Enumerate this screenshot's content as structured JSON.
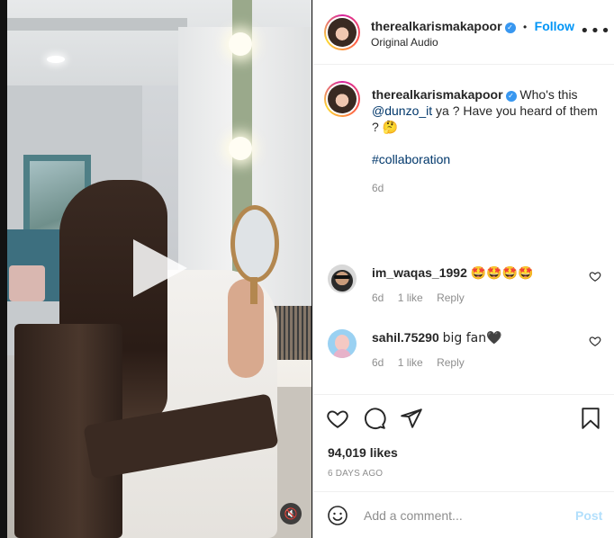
{
  "post": {
    "username": "therealkarismakapoor",
    "follow_label": "Follow",
    "separator": "•",
    "audio": "Original Audio",
    "more_label": "•••",
    "caption_pre": "Who's this ",
    "caption_mention": "@dunzo_it",
    "caption_post": " ya ? Have you heard of them ? 🤔",
    "hashtag": "#collaboration",
    "caption_age": "6d",
    "likes": "94,019 likes",
    "date": "6 DAYS AGO"
  },
  "comments": [
    {
      "username": "im_waqas_1992",
      "text": "🤩🤩🤩🤩",
      "age": "6d",
      "likes": "1 like",
      "reply": "Reply"
    },
    {
      "username": "sahil.75290",
      "text": "big fan🖤",
      "age": "6d",
      "likes": "1 like",
      "reply": "Reply"
    }
  ],
  "composer": {
    "placeholder": "Add a comment...",
    "post_label": "Post"
  },
  "media": {
    "mute_icon": "🔇"
  },
  "icons": [
    "like-icon",
    "comment-icon",
    "share-icon",
    "save-icon",
    "emoji-icon",
    "play-icon",
    "mute-icon",
    "verified-icon",
    "more-icon"
  ],
  "colors": {
    "link": "#0095f6",
    "mention": "#00376b",
    "muted": "#8e8e8e",
    "post_disabled": "#b2dffc",
    "verified": "#3897f0"
  }
}
